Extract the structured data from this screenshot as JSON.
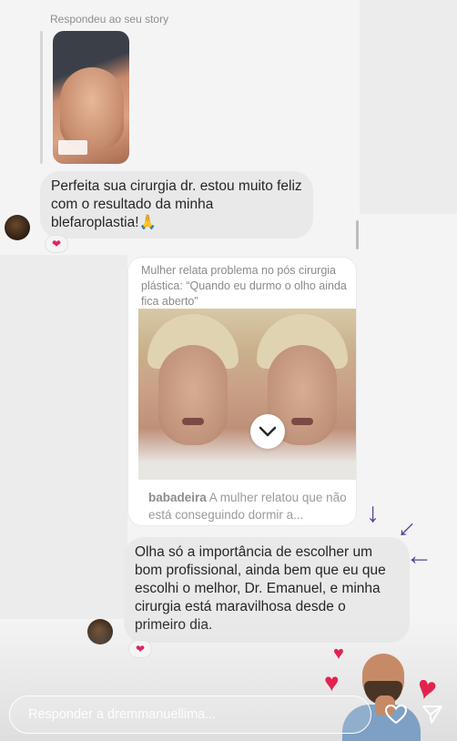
{
  "story_reply": {
    "replied_label": "Respondeu ao seu story"
  },
  "messages": [
    {
      "id": "msg1",
      "text": "Perfeita sua cirurgia dr. estou muito feliz com o resultado da minha blefaroplastia!🙏",
      "reaction": "❤"
    },
    {
      "id": "msg2",
      "text": "Olha só a importância de escolher um bom profissional, ainda bem que eu que escolhi o melhor, Dr. Emanuel, e minha cirurgia está maravilhosa desde o primeiro dia.",
      "reaction": "❤"
    }
  ],
  "shared_post": {
    "headline": "Mulher relata problema no pós cirurgia plástica: “Quando eu durmo o olho ainda fica aberto”",
    "username": "babadeira",
    "caption": "A mulher relatou que não está conseguindo dormir a..."
  },
  "composer": {
    "placeholder": "Responder a dremmanuellima..."
  },
  "colors": {
    "bubble": "#e9e9e9",
    "text": "#262626",
    "muted": "#8e8e8e",
    "heart": "#e0244f",
    "arrow": "#5b3f9a"
  },
  "icons": {
    "like": "heart-outline-icon",
    "send": "send-icon",
    "scroll": "chevron-down-icon"
  }
}
